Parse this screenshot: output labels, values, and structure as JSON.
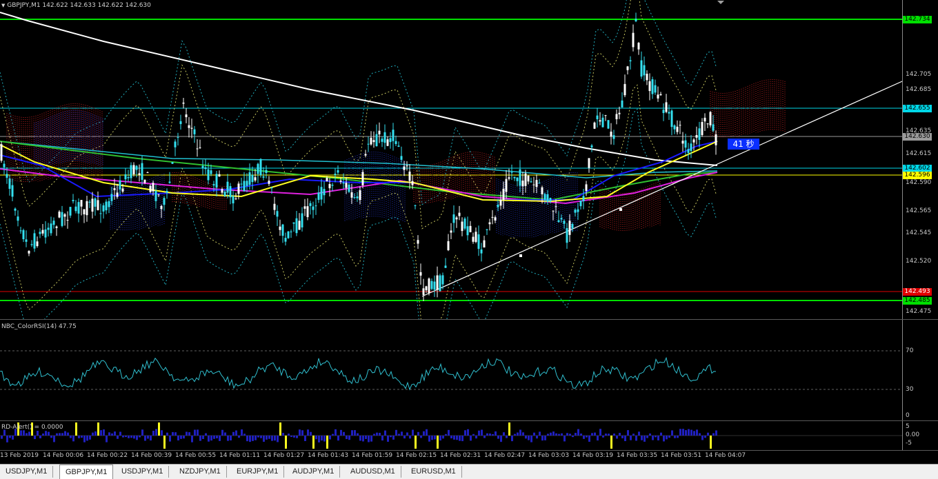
{
  "main_chart": {
    "header": "GBPJPY,M1  142.622 142.633 142.622 142.630",
    "price_scale": [
      "142.705",
      "142.685",
      "142.635",
      "142.615",
      "142.590",
      "142.565",
      "142.545",
      "142.520",
      "142.475"
    ],
    "level_tags": [
      {
        "value": "142.734",
        "color": "#00e000",
        "text": "#000000"
      },
      {
        "value": "142.655",
        "color": "#00d8e8",
        "text": "#000000"
      },
      {
        "value": "142.630",
        "color": "#9a9a9a",
        "text": "#000000"
      },
      {
        "value": "142.602",
        "color": "#00d8e8",
        "text": "#000000"
      },
      {
        "value": "142.596",
        "color": "#ffff00",
        "text": "#000000"
      },
      {
        "value": "142.493",
        "color": "#e00000",
        "text": "#ffffff"
      },
      {
        "value": "142.485",
        "color": "#00e000",
        "text": "#000000"
      }
    ],
    "countdown": "41 秒",
    "colors": {
      "background": "#000000",
      "bull_candle": "#33e0f0",
      "bear_candle": "#ffffff",
      "ma_blue": "#1a1aff",
      "ma_magenta": "#e020e0",
      "ma_green": "#30c030",
      "ma_yellow": "#ffff20",
      "ma_cyan": "#20c0d0",
      "ma_white": "#ffffff"
    }
  },
  "rsi_pane": {
    "caption": "NBC_ColorRSI(14) 47.75",
    "levels": [
      "70",
      "30",
      "0"
    ]
  },
  "rd_pane": {
    "caption": "RD-Alert() = 0.0000",
    "levels": [
      "5",
      "0.00",
      "-5"
    ]
  },
  "time_axis": [
    "13 Feb 2019",
    "14 Feb 00:06",
    "14 Feb 00:22",
    "14 Feb 00:39",
    "14 Feb 00:55",
    "14 Feb 01:11",
    "14 Feb 01:27",
    "14 Feb 01:43",
    "14 Feb 01:59",
    "14 Feb 02:15",
    "14 Feb 02:31",
    "14 Feb 02:47",
    "14 Feb 03:03",
    "14 Feb 03:19",
    "14 Feb 03:35",
    "14 Feb 03:51",
    "14 Feb 04:07"
  ],
  "tabs": [
    "USDJPY,M1",
    "GBPJPY,M1",
    "USDJPY,M1",
    "NZDJPY,M1",
    "EURJPY,M1",
    "AUDJPY,M1",
    "AUDUSD,M1",
    "EURUSD,M1"
  ],
  "active_tab": "GBPJPY,M1"
}
